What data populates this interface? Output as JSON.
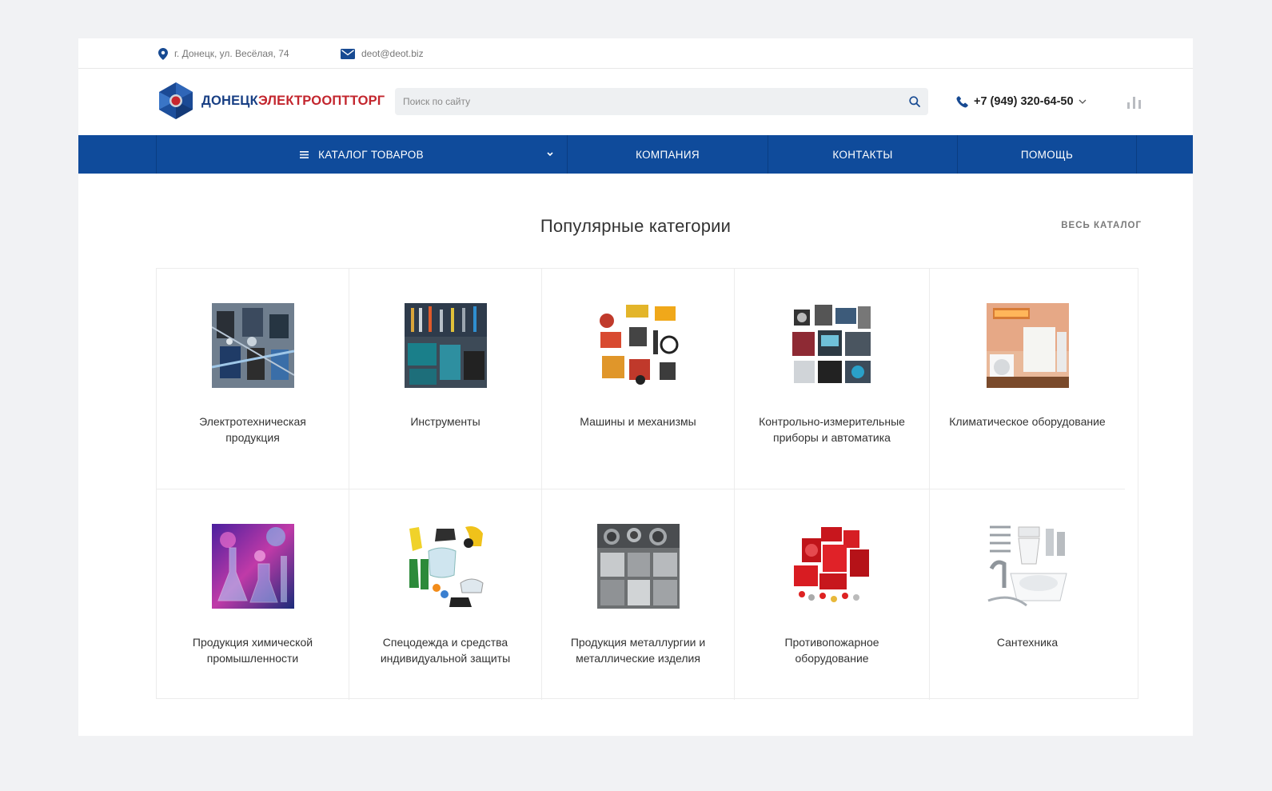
{
  "topbar": {
    "address": "г. Донецк, ул. Весёлая, 74",
    "email": "deot@deot.biz",
    "icons": [
      "location-pin-icon",
      "envelope-icon"
    ]
  },
  "header": {
    "logo_part1": "ДОНЕЦК",
    "logo_part2": "ЭЛЕКТРООПТТОРГ",
    "search_placeholder": "Поиск по сайту",
    "phone": "+7 (949) 320-64-50"
  },
  "nav": {
    "catalog": "КАТАЛОГ ТОВАРОВ",
    "company": "КОМПАНИЯ",
    "contacts": "КОНТАКТЫ",
    "help": "ПОМОЩЬ"
  },
  "section": {
    "title": "Популярные категории",
    "all_link": "ВЕСЬ КАТАЛОГ"
  },
  "categories": [
    {
      "label": "Электротехническая продукция",
      "icon": "electrical-products-image"
    },
    {
      "label": "Инструменты",
      "icon": "tools-image"
    },
    {
      "label": "Машины и механизмы",
      "icon": "machinery-image"
    },
    {
      "label": "Контрольно-измерительные приборы и автоматика",
      "icon": "measuring-instruments-image"
    },
    {
      "label": "Климатическое оборудование",
      "icon": "climate-equipment-image"
    },
    {
      "label": "Продукция химической промышленности",
      "icon": "chemical-products-image"
    },
    {
      "label": "Спецодежда и средства индивидуальной защиты",
      "icon": "protective-gear-image"
    },
    {
      "label": "Продукция металлургии и металлические изделия",
      "icon": "metal-products-image"
    },
    {
      "label": "Противопожарное оборудование",
      "icon": "fire-equipment-image"
    },
    {
      "label": "Сантехника",
      "icon": "plumbing-image"
    }
  ],
  "colors": {
    "brand_blue": "#0f4b9b",
    "logo_blue": "#183f84",
    "logo_red": "#c3262e",
    "background": "#f1f2f4"
  }
}
